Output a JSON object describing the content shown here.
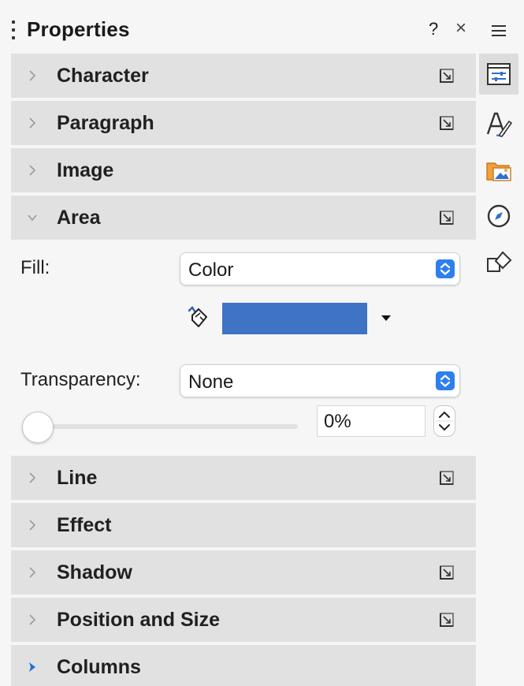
{
  "panel": {
    "title": "Properties",
    "help_label": "?",
    "close_label": "×"
  },
  "sections": {
    "character": "Character",
    "paragraph": "Paragraph",
    "image": "Image",
    "area": "Area",
    "line": "Line",
    "effect": "Effect",
    "shadow": "Shadow",
    "position_size": "Position and Size",
    "columns": "Columns"
  },
  "area": {
    "fill_label": "Fill:",
    "fill_value": "Color",
    "fill_color": "#3f73c3",
    "transparency_label": "Transparency:",
    "transparency_value": "None",
    "transparency_percent": "0%",
    "transparency_level": 0
  },
  "tabbar": {
    "menu_icon": "hamburger-menu-icon",
    "tabs": [
      "properties-icon",
      "styles-icon",
      "gallery-icon",
      "navigator-icon",
      "shapes-icon"
    ],
    "active_tab": "properties-icon"
  },
  "colors": {
    "accent": "#2f7ef0",
    "section_bg": "#e1e1e1",
    "panel_bg": "#f6f6f6"
  }
}
